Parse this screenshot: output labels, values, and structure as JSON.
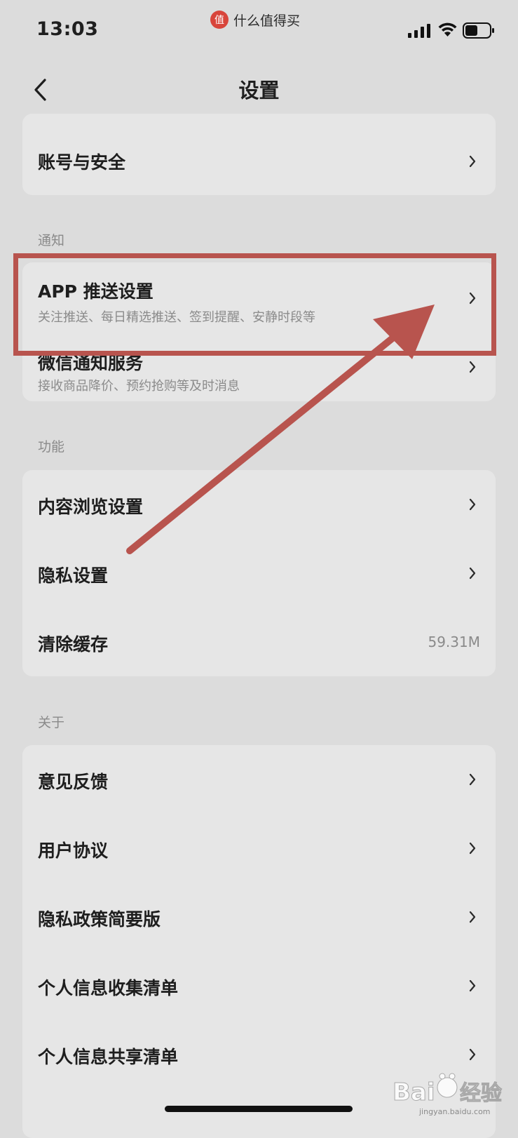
{
  "status_bar": {
    "time": "13:03",
    "app_logo_char": "值",
    "app_name": "什么值得买"
  },
  "nav": {
    "title": "设置"
  },
  "account_section": {
    "items": [
      {
        "title": "账号与安全"
      }
    ]
  },
  "notify_section": {
    "label": "通知",
    "items": [
      {
        "title": "APP 推送设置",
        "subtitle": "关注推送、每日精选推送、签到提醒、安静时段等"
      },
      {
        "title": "微信通知服务",
        "subtitle": "接收商品降价、预约抢购等及时消息"
      }
    ]
  },
  "function_section": {
    "label": "功能",
    "items": [
      {
        "title": "内容浏览设置"
      },
      {
        "title": "隐私设置"
      },
      {
        "title": "清除缓存",
        "value": "59.31M"
      }
    ]
  },
  "about_section": {
    "label": "关于",
    "items": [
      {
        "title": "意见反馈"
      },
      {
        "title": "用户协议"
      },
      {
        "title": "隐私政策简要版"
      },
      {
        "title": "个人信息收集清单"
      },
      {
        "title": "个人信息共享清单"
      }
    ]
  },
  "watermark": {
    "brand": "Baidu经验",
    "url": "jingyan.baidu.com"
  },
  "colors": {
    "background": "#dcdcdc",
    "card": "#e6e6e6",
    "annotation": "#b8544e",
    "app_logo": "#d8453b"
  }
}
